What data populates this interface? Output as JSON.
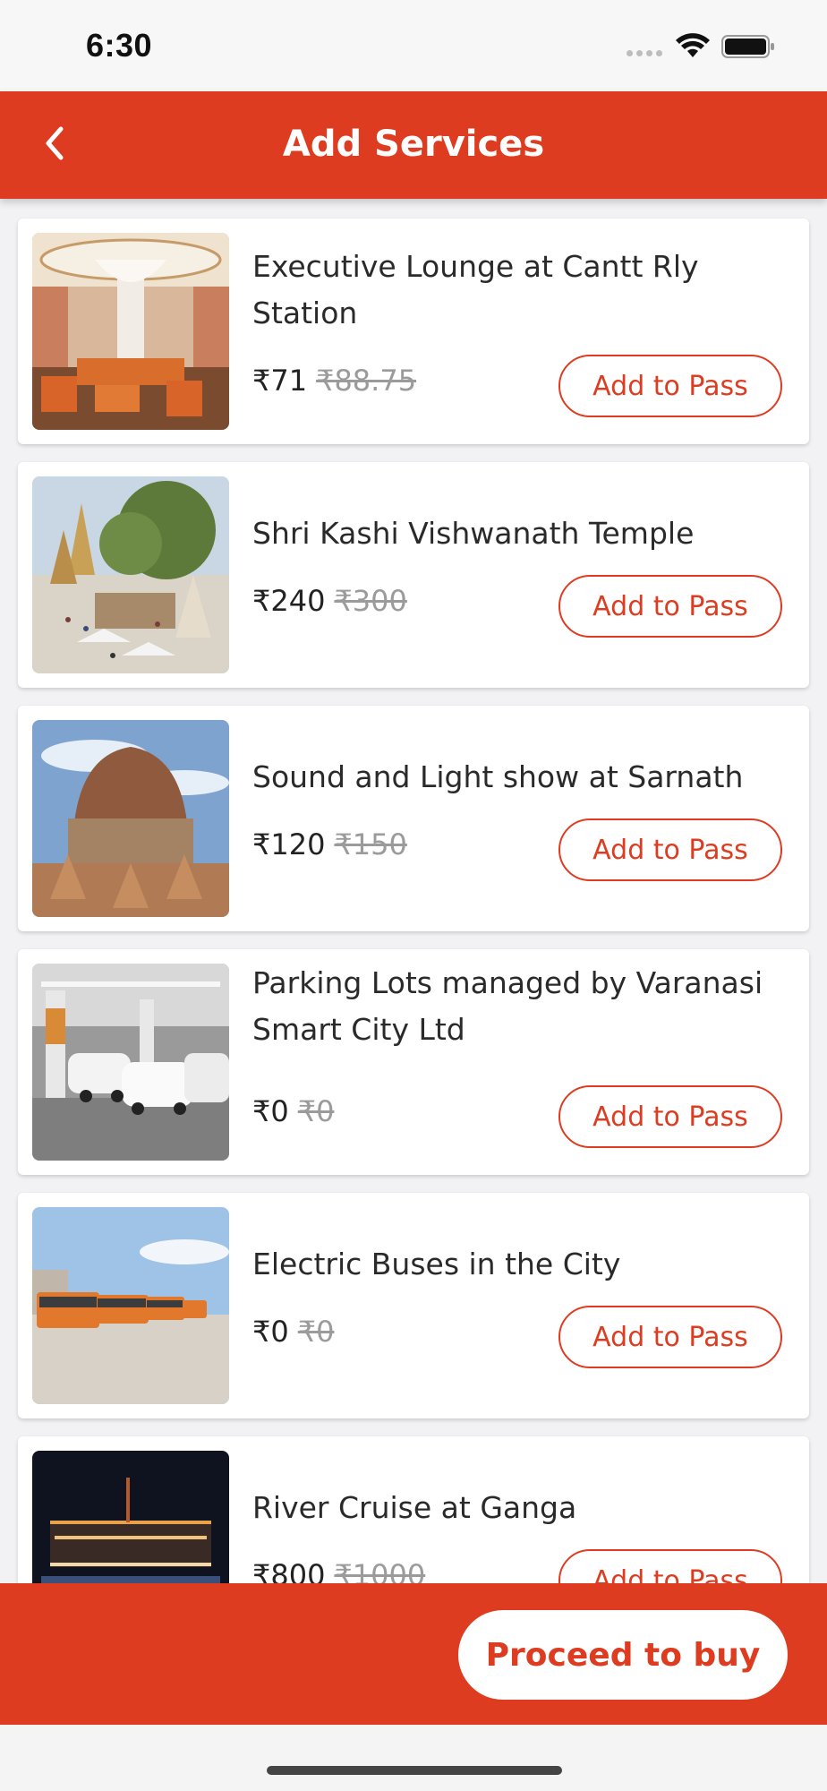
{
  "status_bar": {
    "time": "6:30"
  },
  "header": {
    "title": "Add Services",
    "back_icon": "chevron-left-icon"
  },
  "services": [
    {
      "name": "Executive Lounge at Cantt Rly Station",
      "price": "₹71",
      "original_price": "₹88.75",
      "button_label": "Add to Pass"
    },
    {
      "name": "Shri Kashi Vishwanath Temple",
      "price": "₹240",
      "original_price": "₹300",
      "button_label": "Add to Pass"
    },
    {
      "name": "Sound and Light show at Sarnath",
      "price": "₹120",
      "original_price": "₹150",
      "button_label": "Add to Pass"
    },
    {
      "name": "Parking Lots managed by Varanasi Smart City Ltd",
      "price": "₹0",
      "original_price": "₹0",
      "button_label": "Add to Pass"
    },
    {
      "name": "Electric Buses in the City",
      "price": "₹0",
      "original_price": "₹0",
      "button_label": "Add to Pass"
    },
    {
      "name": "River Cruise at Ganga",
      "price": "₹800",
      "original_price": "₹1000",
      "button_label": "Add to Pass"
    }
  ],
  "footer": {
    "proceed_label": "Proceed to buy"
  },
  "colors": {
    "brand": "#de3c21",
    "strike_price": "#9b9b9b"
  }
}
